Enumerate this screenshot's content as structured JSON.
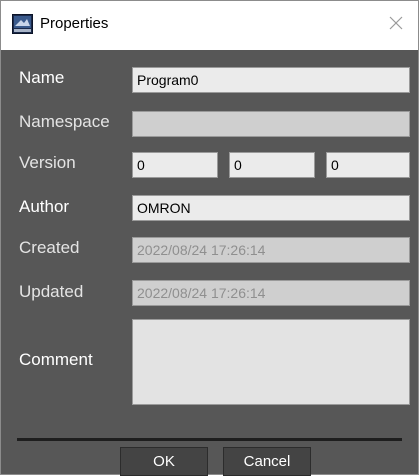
{
  "window": {
    "title": "Properties",
    "close_symbol": "✕",
    "app_icon": "properties-window-icon",
    "close_icon": "close-icon"
  },
  "fields": {
    "name": {
      "label": "Name",
      "value": "Program0"
    },
    "namespace": {
      "label": "Namespace",
      "value": ""
    },
    "version": {
      "label": "Version",
      "major": "0",
      "minor": "0",
      "patch": "0"
    },
    "author": {
      "label": "Author",
      "value": "OMRON"
    },
    "created": {
      "label": "Created",
      "value": "2022/08/24 17:26:14"
    },
    "updated": {
      "label": "Updated",
      "value": "2022/08/24 17:26:14"
    },
    "comment": {
      "label": "Comment",
      "value": ""
    }
  },
  "buttons": {
    "ok": "OK",
    "cancel": "Cancel"
  },
  "colors": {
    "background": "#575757",
    "field": "#ebebeb",
    "readonly_field": "#cfcfcf",
    "label": "#ffffff"
  }
}
